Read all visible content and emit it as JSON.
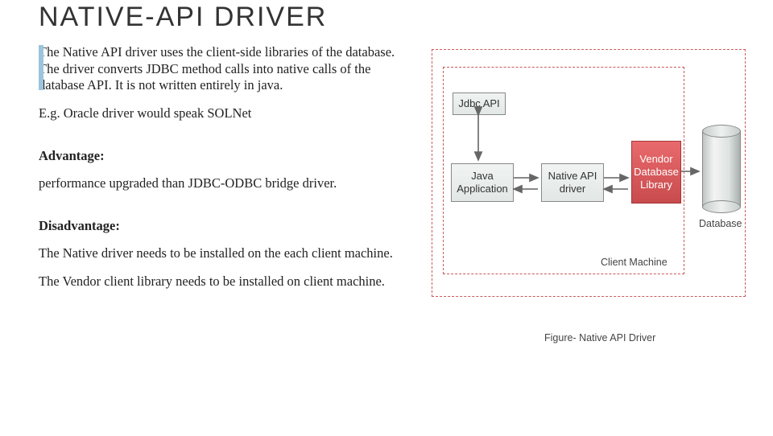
{
  "title": "NATIVE-API DRIVER",
  "para1": "The Native API driver uses the client-side libraries of the database. The driver converts JDBC method calls into native calls of the database API. It is not written entirely in java.",
  "para2": "E.g. Oracle driver would speak SOLNet",
  "adv_heading": "Advantage:",
  "adv_text": "performance upgraded than JDBC-ODBC bridge driver.",
  "dis_heading": "Disadvantage:",
  "dis_text1": "The Native driver needs to be installed on the each client machine.",
  "dis_text2": "The Vendor client library needs to be installed on client machine.",
  "diagram": {
    "jdbc_api": "Jdbc API",
    "java_app": "Java\nApplication",
    "native_api": "Native API\ndriver",
    "vendor_lib": "Vendor\nDatabase\nLibrary",
    "database": "Database",
    "client_machine": "Client Machine",
    "figure_caption": "Figure- Native API Driver"
  }
}
